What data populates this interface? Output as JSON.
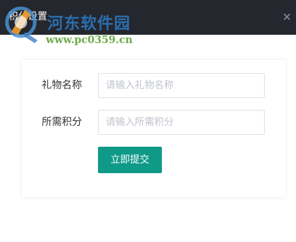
{
  "dialog": {
    "title": "积分设置",
    "close_icon": "close-icon"
  },
  "watermark": {
    "site_name": "河东软件园",
    "url": "www.pc0359.cn"
  },
  "form": {
    "gift_name": {
      "label": "礼物名称",
      "value": "",
      "placeholder": "请输入礼物名称"
    },
    "points": {
      "label": "所需积分",
      "value": "",
      "placeholder": "请输入所需积分"
    },
    "submit_label": "立即提交"
  },
  "colors": {
    "titlebar": "#24272e",
    "submit_button": "#0f9a88",
    "watermark_blue": "#2c7bc4",
    "watermark_green": "#6cab4a"
  }
}
